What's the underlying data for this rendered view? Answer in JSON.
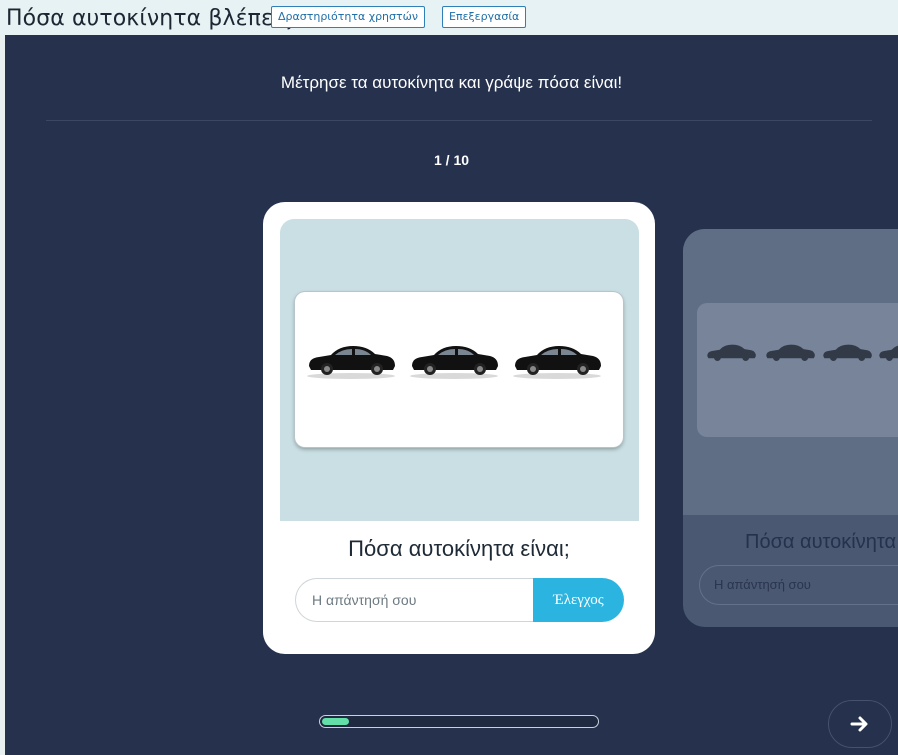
{
  "header": {
    "title": "Πόσα αυτοκίνητα βλέπεις;",
    "activity_button": "Δραστηριότητα χρηστών",
    "edit_button": "Επεξεργασία"
  },
  "activity": {
    "instruction": "Μέτρησε τα αυτοκίνητα και γράψε πόσα είναι!",
    "counter": "1 / 10",
    "progress_fraction": 0.1
  },
  "card": {
    "question": "Πόσα αυτοκίνητα είναι;",
    "answer_placeholder": "Η απάντησή σου",
    "check_label": "Έλεγχος",
    "image_icon": "three-black-cars"
  },
  "next_card": {
    "question": "Πόσα αυτοκίνητα",
    "answer_placeholder": "Η απάντησή σου",
    "image_icon": "row-of-cars"
  },
  "colors": {
    "stage_bg": "#25314d",
    "accent": "#2bb4e0",
    "progress": "#62e0a8"
  }
}
